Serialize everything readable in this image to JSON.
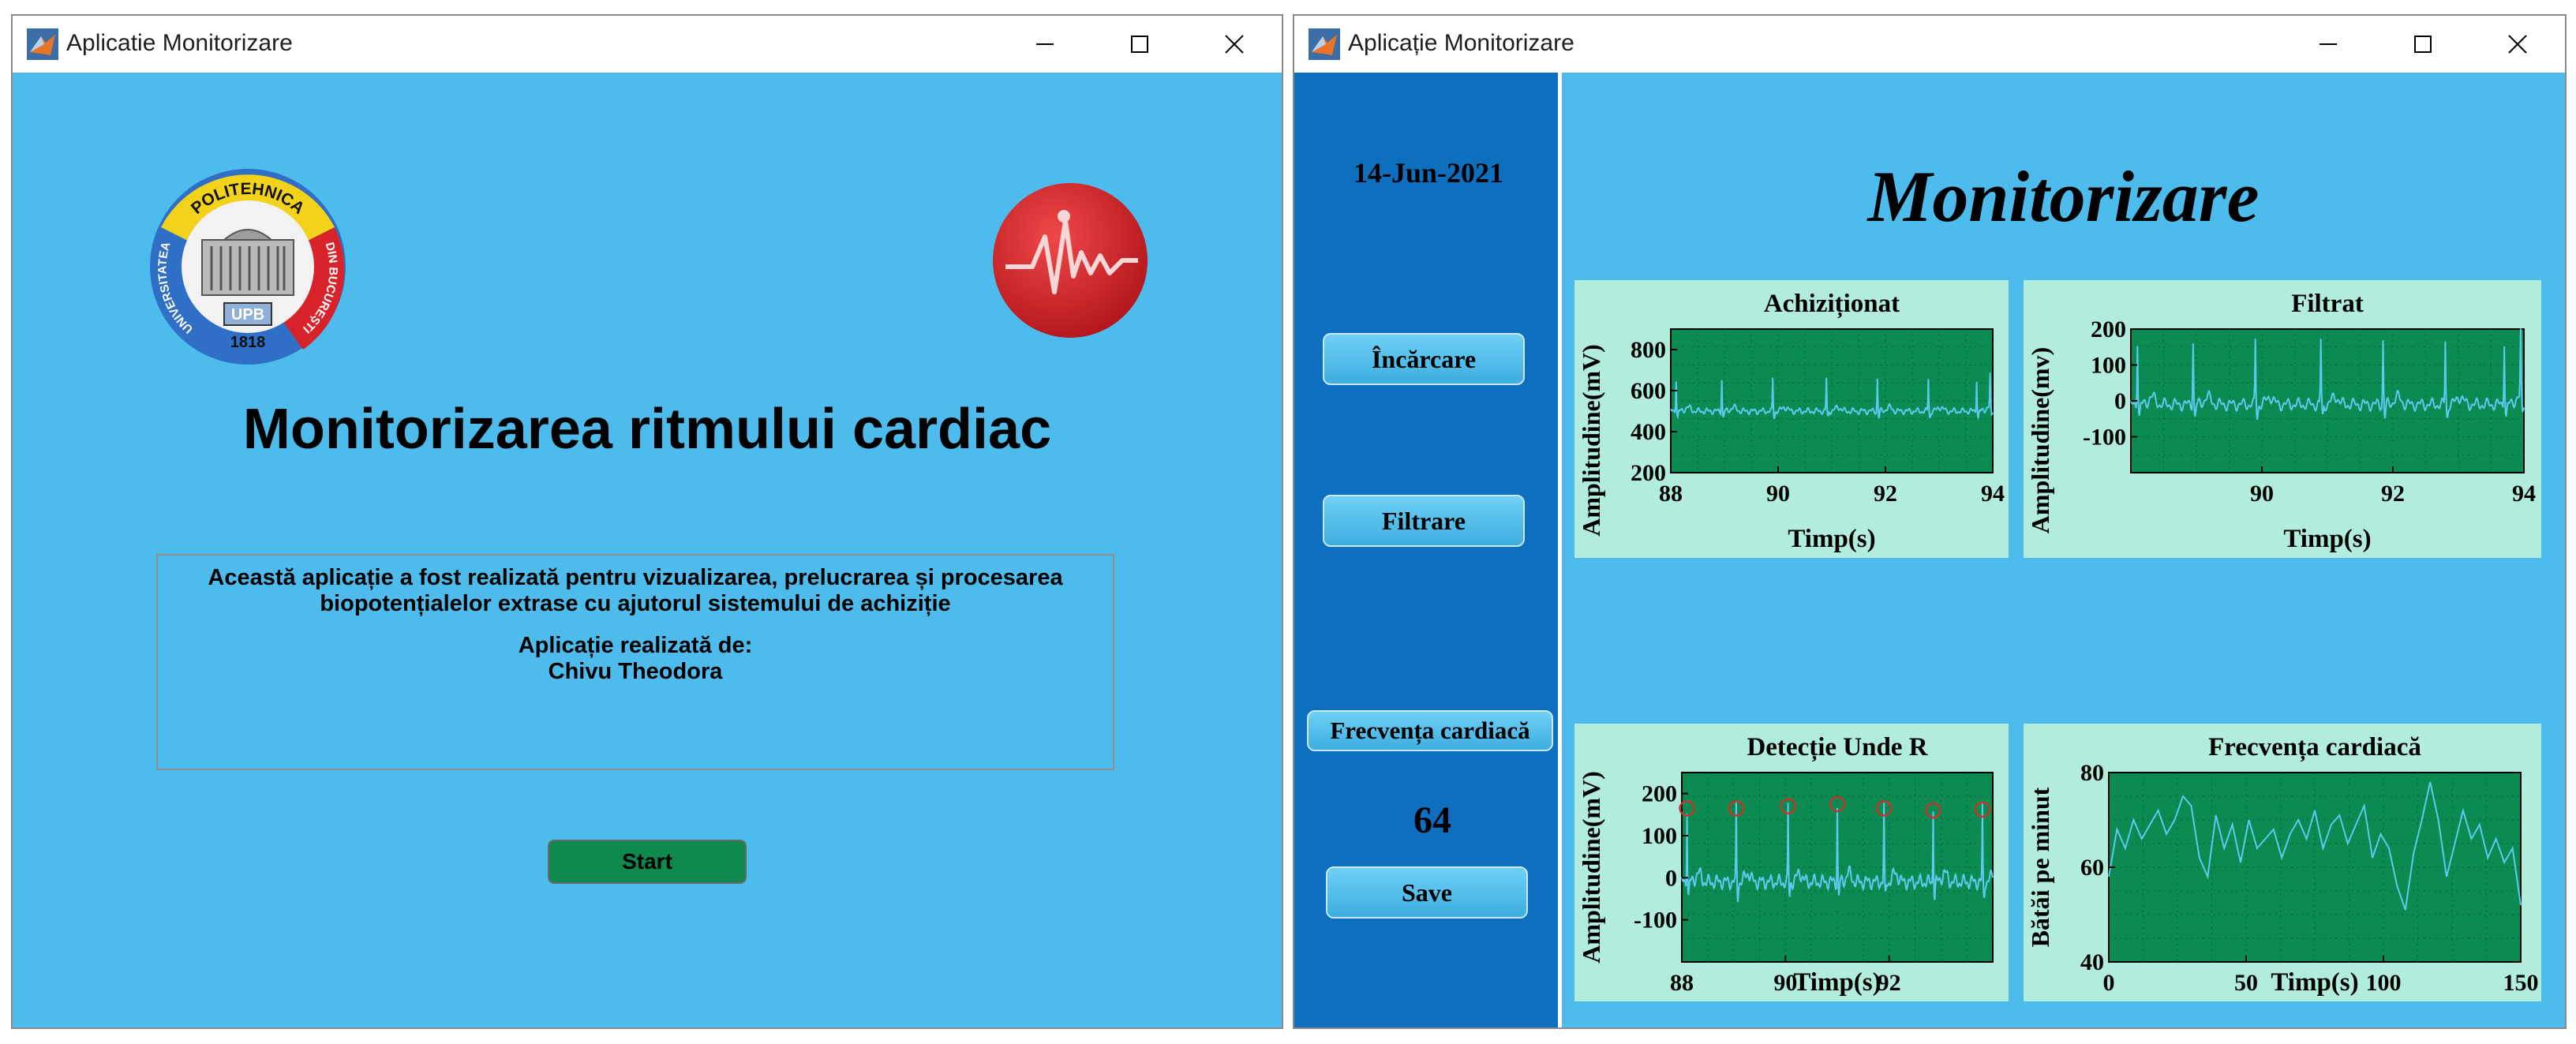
{
  "windows": [
    {
      "title": "Aplicatie Monitorizare",
      "logos": {
        "left": "Universitatea Politehnica din Bucuresti logo",
        "right": "cardiac pulse logo"
      },
      "upb_logo_text": {
        "top": "POLITEHNICA",
        "left": "UNIVERSITATEA",
        "right": "DIN BUCUREȘTI",
        "center": "UPB",
        "year": "1818"
      },
      "heading": "Monitorizarea ritmului cardiac",
      "info": {
        "line1": "Această aplicație a fost realizată pentru vizualizarea, prelucrarea și procesarea",
        "line2": "biopotențialelor extrase cu ajutorul sistemului de achiziție",
        "line3": "Aplicație realizată de:",
        "line4": "Chivu Theodora"
      },
      "start_button": "Start"
    },
    {
      "title": "Aplicație Monitorizare",
      "date": "14-Jun-2021",
      "buttons": {
        "load": "Încărcare",
        "filter": "Filtrare",
        "heart_rate": "Frecvența cardiacă",
        "save": "Save"
      },
      "heart_rate_value": "64",
      "heading": "Monitorizare"
    }
  ],
  "colors": {
    "background": "#4dbced",
    "sidebar": "#0f6fbf",
    "plot_background": "#0b8a52",
    "panel": "#b2ecdd",
    "signal": "#5fc8ee",
    "start_button": "#0f8a4c"
  },
  "chart_data": [
    {
      "type": "line",
      "title": "Achiziționat",
      "xlabel": "Timp(s)",
      "ylabel": "Amplitudine(mV)",
      "xlim": [
        88,
        94
      ],
      "ylim": [
        200,
        900
      ],
      "xticks": [
        "88",
        "90",
        "92",
        "94"
      ],
      "yticks": [
        "200",
        "400",
        "600",
        "800"
      ],
      "baseline": 500,
      "peak": 660,
      "r_peaks_x": [
        88.1,
        88.95,
        89.9,
        90.9,
        91.85,
        92.8,
        93.7,
        93.95
      ]
    },
    {
      "type": "line",
      "title": "Filtrat",
      "xlabel": "Timp(s)",
      "ylabel": "Amplitudine(mv)",
      "xlim": [
        88,
        94
      ],
      "ylim": [
        -200,
        200
      ],
      "xticks": [
        "90",
        "92",
        "94"
      ],
      "yticks": [
        "-100",
        "0",
        "100",
        "200"
      ],
      "baseline": -10,
      "peak": 170,
      "r_peaks_x": [
        88.1,
        88.95,
        89.9,
        90.9,
        91.85,
        92.8,
        93.7,
        93.95
      ]
    },
    {
      "type": "line",
      "title": "Detecție Unde R",
      "xlabel": "Timp(s)",
      "ylabel": "Amplitudine(mV)",
      "xlim": [
        88,
        94
      ],
      "ylim": [
        -200,
        250
      ],
      "xticks": [
        "88",
        "90",
        "92"
      ],
      "yticks": [
        "-100",
        "0",
        "100",
        "200"
      ],
      "baseline": -10,
      "peak": 170,
      "r_peaks_x": [
        88.1,
        89.05,
        90.05,
        91.0,
        91.9,
        92.85,
        93.8
      ],
      "detected_r_peaks": [
        {
          "x": 88.1,
          "y": 165
        },
        {
          "x": 89.05,
          "y": 165
        },
        {
          "x": 90.05,
          "y": 170
        },
        {
          "x": 91.0,
          "y": 175
        },
        {
          "x": 91.9,
          "y": 165
        },
        {
          "x": 92.85,
          "y": 160
        },
        {
          "x": 93.8,
          "y": 162
        }
      ]
    },
    {
      "type": "line",
      "title": "Frecvența cardiacă",
      "xlabel": "Timp(s)",
      "ylabel": "Bătăi pe minut",
      "xlim": [
        0,
        150
      ],
      "ylim": [
        40,
        80
      ],
      "xticks": [
        "0",
        "50",
        "100",
        "150"
      ],
      "yticks": [
        "40",
        "60",
        "80"
      ],
      "x": [
        0,
        3,
        6,
        9,
        12,
        15,
        18,
        21,
        24,
        27,
        30,
        33,
        36,
        39,
        42,
        45,
        48,
        51,
        54,
        57,
        60,
        63,
        66,
        69,
        72,
        75,
        78,
        81,
        84,
        87,
        90,
        93,
        96,
        99,
        102,
        105,
        108,
        111,
        114,
        117,
        120,
        123,
        126,
        129,
        132,
        135,
        138,
        141,
        144,
        147,
        150
      ],
      "y": [
        58,
        68,
        64,
        70,
        66,
        69,
        72,
        67,
        70,
        75,
        73,
        62,
        58,
        71,
        64,
        69,
        61,
        70,
        64,
        66,
        68,
        62,
        67,
        70,
        66,
        72,
        64,
        69,
        71,
        65,
        69,
        73,
        62,
        67,
        64,
        56,
        51,
        63,
        70,
        78,
        70,
        58,
        65,
        72,
        66,
        69,
        62,
        66,
        61,
        64,
        52
      ]
    }
  ]
}
